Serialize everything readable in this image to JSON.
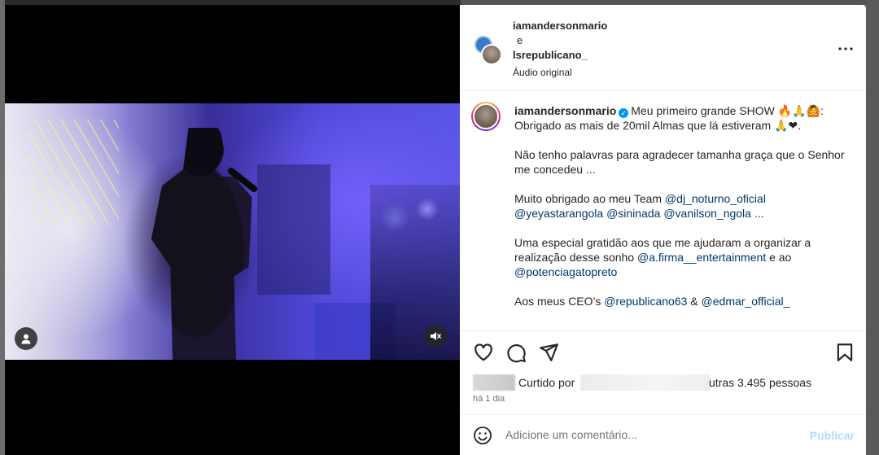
{
  "post": {
    "header": {
      "author1": "iamandersonmario",
      "joiner": "e",
      "author2": "lsrepublicano_",
      "audio": "Áudio original"
    },
    "caption": {
      "username": "iamandersonmario",
      "line1_text": "Meu primeiro grande SHOW 🔥🙏🙆:",
      "line2_text": "Obrigado as mais de 20mil Almas que lá estiveram 🙏❤.",
      "para2": "Não tenho palavras para agradecer tamanha graça que o Senhor me concedeu ...",
      "para3_prefix": "Muito obrigado ao meu Team",
      "para3_m1": "@dj_noturno_oficial",
      "para3_m2": "@yeyastarangola",
      "para3_m3": "@sininada",
      "para3_m4": "@vanilson_ngola",
      "para3_suffix": "...",
      "para4_prefix": "Uma especial gratidão aos que me ajudaram a organizar a realização desse sonho",
      "para4_m1": "@a.firma__entertainment",
      "para4_and": "e ao",
      "para4_m2": "@potenciagatopreto",
      "para5_prefix": "Aos meus CEO’s",
      "para5_m1": "@republicano63",
      "para5_amp": "&",
      "para5_m2": "@edmar_official_"
    },
    "likes": {
      "text_a": "Curtido por",
      "text_b": "utras 3.495 pessoas"
    },
    "time_ago": "há 1 dia",
    "comment_box": {
      "placeholder": "Adicione um comentário...",
      "post_label": "Publicar"
    }
  },
  "icons": {
    "more": "more-options-icon",
    "like": "heart-icon",
    "comment": "comment-icon",
    "share": "share-icon",
    "save": "bookmark-icon",
    "emoji": "emoji-icon",
    "user_tags": "user-tag-icon",
    "mute": "audio-muted-icon"
  },
  "colors": {
    "link": "#00376b",
    "post_button_disabled": "#b3dbff",
    "verified": "#0095f6",
    "muted_text": "#737373"
  }
}
